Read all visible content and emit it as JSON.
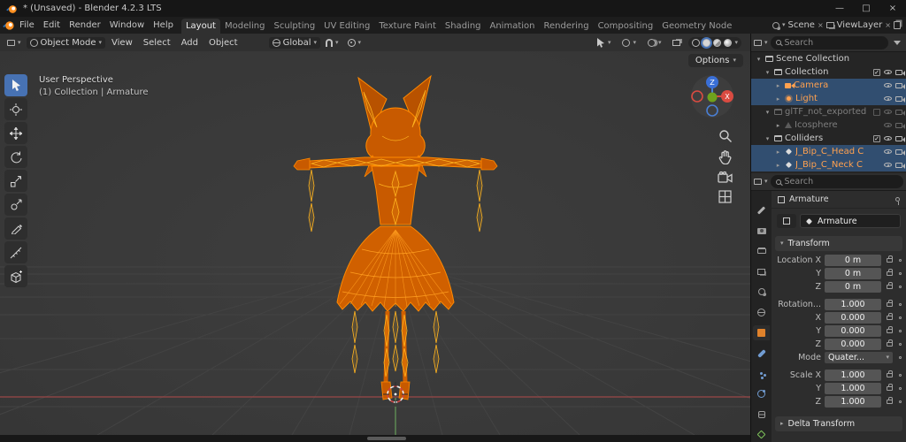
{
  "titlebar": {
    "title": "* (Unsaved) - Blender 4.2.3 LTS",
    "minimize": "—",
    "maximize": "□",
    "close": "×"
  },
  "menubar": {
    "menus": [
      {
        "label": "File"
      },
      {
        "label": "Edit"
      },
      {
        "label": "Render"
      },
      {
        "label": "Window"
      },
      {
        "label": "Help"
      }
    ],
    "tabs": [
      {
        "label": "Layout"
      },
      {
        "label": "Modeling"
      },
      {
        "label": "Sculpting"
      },
      {
        "label": "UV Editing"
      },
      {
        "label": "Texture Paint"
      },
      {
        "label": "Shading"
      },
      {
        "label": "Animation"
      },
      {
        "label": "Rendering"
      },
      {
        "label": "Compositing"
      },
      {
        "label": "Geometry Node"
      }
    ],
    "active_tab": "Layout",
    "scene_label": "Scene",
    "viewlayer_label": "ViewLayer"
  },
  "viewport_header": {
    "mode": "Object Mode",
    "menus": [
      {
        "label": "View"
      },
      {
        "label": "Select"
      },
      {
        "label": "Add"
      },
      {
        "label": "Object"
      }
    ],
    "orientation": "Global",
    "options_label": "Options"
  },
  "viewport_overlay": {
    "line1": "User Perspective",
    "line2": "(1) Collection | Armature"
  },
  "toolbar": {
    "tools": [
      "tweak-select",
      "cursor",
      "move",
      "rotate",
      "scale",
      "transform",
      "annotate",
      "measure",
      "add-cube"
    ],
    "active": "tweak-select"
  },
  "gizmo": {
    "x": "X",
    "z": "Z"
  },
  "outliner": {
    "search_placeholder": "Search",
    "rows": [
      {
        "label": "Scene Collection",
        "caret": "▾"
      },
      {
        "label": "Collection",
        "caret": "▾"
      },
      {
        "label": "Camera",
        "caret": "▸"
      },
      {
        "label": "Light",
        "caret": "▸"
      },
      {
        "label": "glTF_not_exported",
        "caret": "▾"
      },
      {
        "label": "Icosphere",
        "caret": "▸"
      },
      {
        "label": "Colliders",
        "caret": "▾"
      },
      {
        "label": "J_Bip_C_Head C",
        "caret": "▸"
      },
      {
        "label": "J_Bip_C_Neck C",
        "caret": "▸"
      }
    ]
  },
  "properties": {
    "search_placeholder": "Search",
    "breadcrumb": "Armature",
    "name_field": "Armature",
    "panels": {
      "transform": "Transform",
      "delta": "Delta Transform"
    },
    "fields": [
      {
        "label": "Location X",
        "value": "0 m"
      },
      {
        "label": "Y",
        "value": "0 m"
      },
      {
        "label": "Z",
        "value": "0 m"
      },
      {
        "label": "Rotation...",
        "value": "1.000"
      },
      {
        "label": "X",
        "value": "0.000"
      },
      {
        "label": "Y",
        "value": "0.000"
      },
      {
        "label": "Z",
        "value": "0.000"
      },
      {
        "label": "Mode",
        "value": "Quater...",
        "dropdown": true
      },
      {
        "label": "Scale X",
        "value": "1.000"
      },
      {
        "label": "Y",
        "value": "1.000"
      },
      {
        "label": "Z",
        "value": "1.000"
      }
    ]
  },
  "colors": {
    "accent": "#4772b3",
    "selection_bg": "#314e70",
    "selected_text": "#ffa14f",
    "wire_orange": "#ff8a00"
  },
  "icons": {
    "search-icon": "magnifier",
    "filter-icon": "funnel",
    "eye-icon": "visibility",
    "camera-icon": "render-visibility",
    "checkbox-icon": "exclude-toggle",
    "lock-icon": "open-padlock",
    "magnet-icon": "snapping",
    "globe-icon": "orientation",
    "pin-icon": "pin",
    "bone-icon": "armature-bone"
  }
}
